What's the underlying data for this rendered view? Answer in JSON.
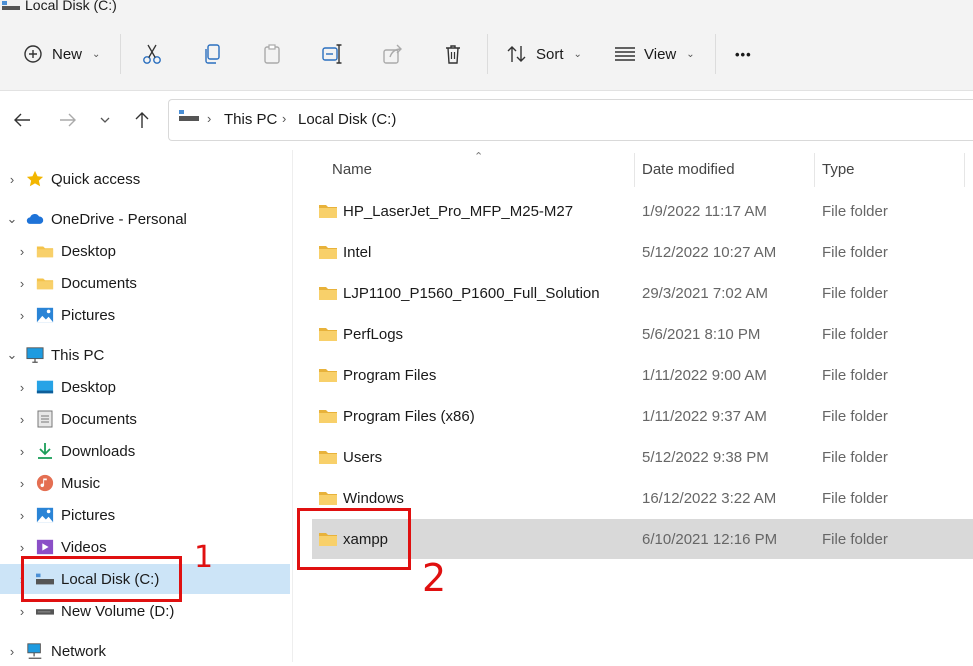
{
  "window": {
    "title": "Local Disk (C:)"
  },
  "toolbar": {
    "new_label": "New",
    "sort_label": "Sort",
    "view_label": "View",
    "more_label": "•••"
  },
  "address": {
    "crumbs": [
      "This PC",
      "Local Disk (C:)"
    ]
  },
  "sidebar": {
    "items": [
      {
        "label": "Quick access",
        "icon": "star-icon"
      },
      {
        "label": "OneDrive - Personal",
        "icon": "cloud-icon"
      },
      {
        "label": "Desktop",
        "icon": "folder-icon"
      },
      {
        "label": "Documents",
        "icon": "folder-icon"
      },
      {
        "label": "Pictures",
        "icon": "pictures-icon"
      },
      {
        "label": "This PC",
        "icon": "monitor-icon"
      },
      {
        "label": "Desktop",
        "icon": "desktop-icon"
      },
      {
        "label": "Documents",
        "icon": "documents-icon"
      },
      {
        "label": "Downloads",
        "icon": "download-icon"
      },
      {
        "label": "Music",
        "icon": "music-icon"
      },
      {
        "label": "Pictures",
        "icon": "pictures-icon"
      },
      {
        "label": "Videos",
        "icon": "videos-icon"
      },
      {
        "label": "Local Disk (C:)",
        "icon": "drive-icon"
      },
      {
        "label": "New Volume (D:)",
        "icon": "drive-icon"
      },
      {
        "label": "Network",
        "icon": "network-icon"
      }
    ]
  },
  "columns": {
    "name": "Name",
    "date": "Date modified",
    "type": "Type"
  },
  "files": [
    {
      "name": "HP_LaserJet_Pro_MFP_M25-M27",
      "date": "1/9/2022 11:17 AM",
      "type": "File folder"
    },
    {
      "name": "Intel",
      "date": "5/12/2022 10:27 AM",
      "type": "File folder"
    },
    {
      "name": "LJP1100_P1560_P1600_Full_Solution",
      "date": "29/3/2021 7:02 AM",
      "type": "File folder"
    },
    {
      "name": "PerfLogs",
      "date": "5/6/2021 8:10 PM",
      "type": "File folder"
    },
    {
      "name": "Program Files",
      "date": "1/11/2022 9:00 AM",
      "type": "File folder"
    },
    {
      "name": "Program Files (x86)",
      "date": "1/11/2022 9:37 AM",
      "type": "File folder"
    },
    {
      "name": "Users",
      "date": "5/12/2022 9:38 PM",
      "type": "File folder"
    },
    {
      "name": "Windows",
      "date": "16/12/2022 3:22 AM",
      "type": "File folder"
    },
    {
      "name": "xampp",
      "date": "6/10/2021 12:16 PM",
      "type": "File folder"
    }
  ],
  "annotations": {
    "step1": "1",
    "step2": "2"
  },
  "colors": {
    "annotation": "#e01010",
    "selection_sidebar": "#cce4f7",
    "selection_row": "#d9d9d9",
    "folder": "#f4c34a"
  }
}
